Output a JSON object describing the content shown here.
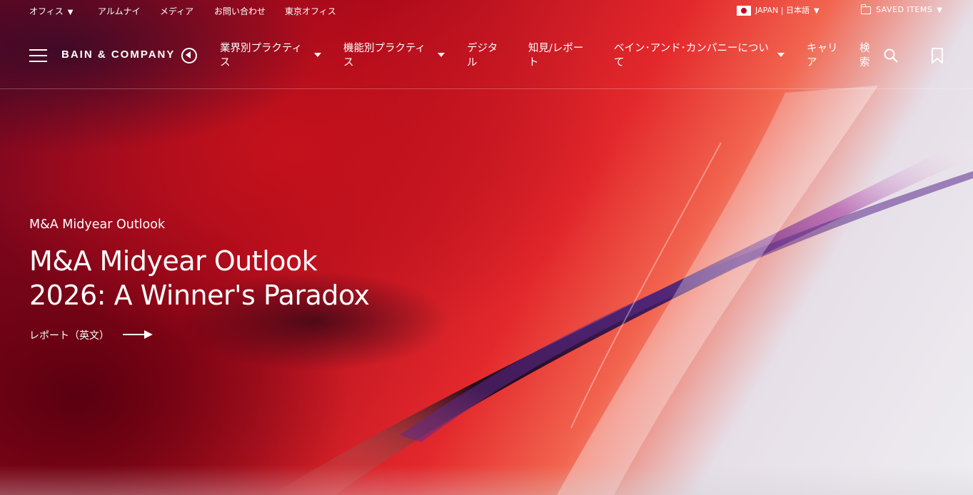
{
  "utility": {
    "offices": "オフィス",
    "alumni": "アルムナイ",
    "media": "メディア",
    "contact": "お問い合わせ",
    "tokyo": "東京オフィス",
    "region": "JAPAN | 日本語",
    "saved": "SAVED ITEMS"
  },
  "brand": {
    "logo": "BAIN & COMPANY"
  },
  "nav": {
    "items": [
      {
        "label": "業界別プラクティス"
      },
      {
        "label": "機能別プラクティス"
      },
      {
        "label": "デジタル"
      },
      {
        "label": "知見/レポート"
      },
      {
        "label": "ベイン･アンド･カンパニーについて"
      },
      {
        "label": "キャリア"
      },
      {
        "label": "検索"
      }
    ]
  },
  "hero": {
    "eyebrow": "M&A Midyear Outlook",
    "headline": "M&A Midyear Outlook 2026: A Winner's Paradox",
    "cta": "レポート（英文）"
  },
  "colors": {
    "brand_red": "#cc0000",
    "text": "#ffffff"
  },
  "icons": [
    "hamburger-icon",
    "japan-flag-icon",
    "folder-icon",
    "search-icon",
    "bookmark-icon",
    "arrow-right-icon"
  ]
}
